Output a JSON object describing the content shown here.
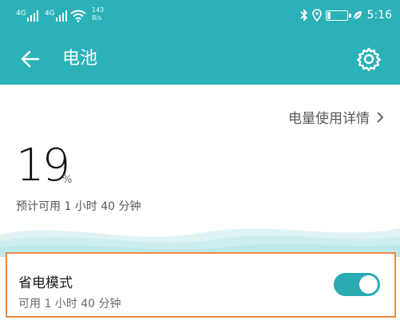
{
  "status_bar": {
    "signal1_label": "4G",
    "signal2_label": "4G",
    "speed_value": "143",
    "speed_unit": "B/s",
    "battery_level": "19",
    "time": "5:16",
    "icons": [
      "signal-icon",
      "wifi-icon",
      "bluetooth-icon",
      "location-icon",
      "battery-icon",
      "leaf-icon"
    ]
  },
  "app_bar": {
    "title": "电池",
    "back_icon": "back-arrow-icon",
    "settings_icon": "gear-icon"
  },
  "usage_detail": {
    "label": "电量使用详情",
    "icon": "chevron-right-icon"
  },
  "battery": {
    "percent": "19",
    "unit": "%",
    "estimate": "预计可用 1 小时 40 分钟"
  },
  "power_saving": {
    "title": "省电模式",
    "subtitle": "可用 1 小时 40 分钟",
    "enabled": true
  },
  "colors": {
    "accent": "#2bb1b8",
    "toggle_on": "#2aaab1",
    "highlight_border": "#f08a3a"
  }
}
